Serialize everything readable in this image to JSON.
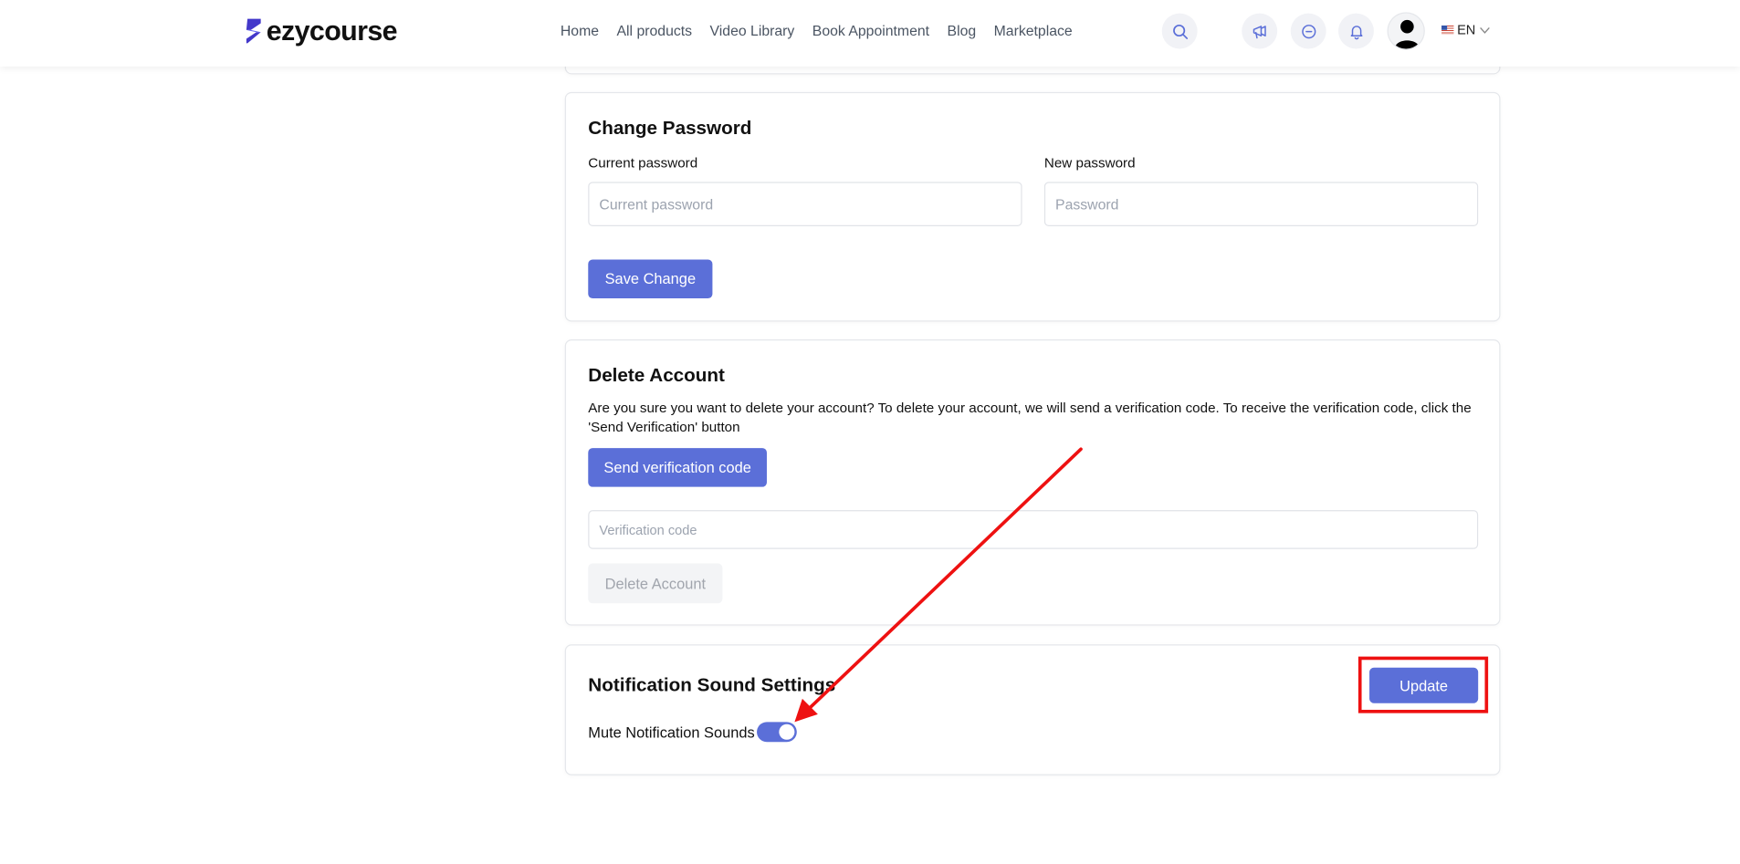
{
  "brand": {
    "name": "ezycourse",
    "accent": "#5b6fd8",
    "logo_color": "#4338ca"
  },
  "nav": {
    "items": [
      "Home",
      "All products",
      "Video Library",
      "Book Appointment",
      "Blog",
      "Marketplace"
    ]
  },
  "header_icons": [
    "search-icon",
    "megaphone-icon",
    "chat-icon",
    "bell-icon"
  ],
  "language": {
    "code": "EN"
  },
  "change_password": {
    "title": "Change Password",
    "current_label": "Current password",
    "current_placeholder": "Current password",
    "new_label": "New password",
    "new_placeholder": "Password",
    "save_label": "Save Change"
  },
  "delete_account": {
    "title": "Delete Account",
    "description": "Are you sure you want to delete your account? To delete your account, we will send a verification code. To receive the verification code, click the 'Send Verification' button",
    "send_label": "Send verification code",
    "code_placeholder": "Verification code",
    "delete_label": "Delete Account"
  },
  "notification_sound": {
    "title": "Notification Sound Settings",
    "mute_label": "Mute Notification Sounds",
    "mute_enabled": true,
    "update_label": "Update"
  },
  "annotation_color": "#ee1111"
}
